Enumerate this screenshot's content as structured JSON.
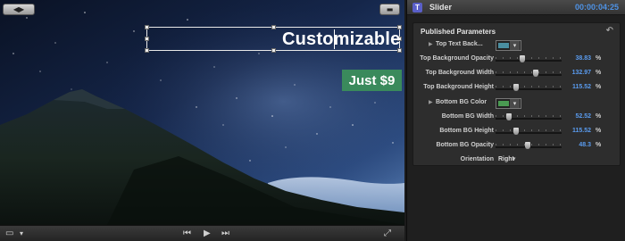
{
  "viewer": {
    "title_text": "Customizable",
    "price_text": "Just $9",
    "left_view_glyphs": "◀▶",
    "right_view_glyph": "▬",
    "transport": {
      "view_glyph": "▭",
      "view_menu_glyph": "▾",
      "prev_glyph": "⏮",
      "play_glyph": "▶",
      "next_glyph": "⏭",
      "fullscreen_glyph": "⤢"
    }
  },
  "inspector": {
    "title": "Slider",
    "timecode": "00:00:04:25",
    "app_icon_glyph": "T",
    "section_title": "Published Parameters",
    "reset_glyph": "↶",
    "params": [
      {
        "label": "Top Text Back...",
        "kind": "color",
        "disclosure": "▶",
        "color": "#4a8ea0"
      },
      {
        "label": "Top Background Opacity",
        "kind": "slider",
        "value": "38.83",
        "unit": "%",
        "level": 0.39
      },
      {
        "label": "Top Background Width",
        "kind": "slider",
        "value": "132.97",
        "unit": "%",
        "level": 0.62
      },
      {
        "label": "Top Background Height",
        "kind": "slider",
        "value": "115.52",
        "unit": "%",
        "level": 0.3
      },
      {
        "label": "Bottom BG Color",
        "kind": "color",
        "disclosure": "▶",
        "color": "#4a9a52"
      },
      {
        "label": "Bottom BG Width",
        "kind": "slider",
        "value": "52.52",
        "unit": "%",
        "level": 0.18
      },
      {
        "label": "Bottom BG Height",
        "kind": "slider",
        "value": "115.52",
        "unit": "%",
        "level": 0.3
      },
      {
        "label": "Bottom BG Opacity",
        "kind": "slider",
        "value": "48.3",
        "unit": "%",
        "level": 0.48
      },
      {
        "label": "Orientation",
        "kind": "select",
        "value": "Right",
        "chevron": "▾"
      }
    ]
  },
  "colors": {
    "accent_blue": "#4f93e6",
    "price_green": "#3a8a5c"
  }
}
